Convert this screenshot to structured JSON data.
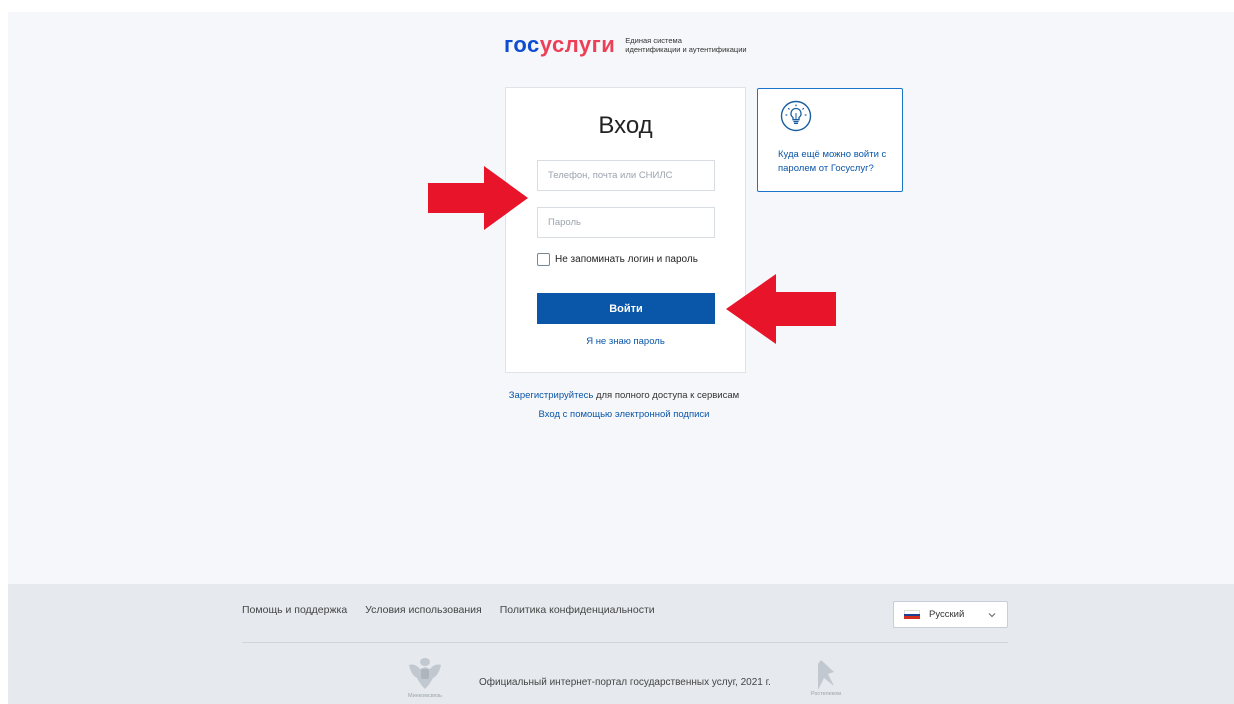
{
  "logo": {
    "part1": "гос",
    "part2": "услуги",
    "subtitle_line1": "Единая система",
    "subtitle_line2": "идентификации и аутентификации"
  },
  "login": {
    "title": "Вход",
    "login_placeholder": "Телефон, почта или СНИЛС",
    "login_value": "",
    "password_placeholder": "Пароль",
    "password_value": "",
    "remember_label": "Не запоминать логин и пароль",
    "remember_checked": false,
    "submit_label": "Войти",
    "forgot_label": "Я не знаю пароль"
  },
  "tip": {
    "icon": "lightbulb-icon",
    "text": "Куда ещё можно войти с паролем от Госуслуг?"
  },
  "links": {
    "register_link": "Зарегистрируйтесь",
    "register_rest": " для полного доступа к сервисам",
    "esign": "Вход с помощью электронной подписи"
  },
  "footer": {
    "help": "Помощь и поддержка",
    "terms": "Условия использования",
    "privacy": "Политика конфиденциальности",
    "language": "Русский",
    "official_text": "Официальный интернет-портал государственных услуг, 2021 г.",
    "emblem_caption": "Минкомсвязь",
    "rostelecom_caption": "Ростелеком"
  },
  "colors": {
    "brand_blue": "#0d4cd3",
    "brand_red": "#ee3f58",
    "button_blue": "#0a56a8",
    "arrow_red": "#e8142a"
  }
}
